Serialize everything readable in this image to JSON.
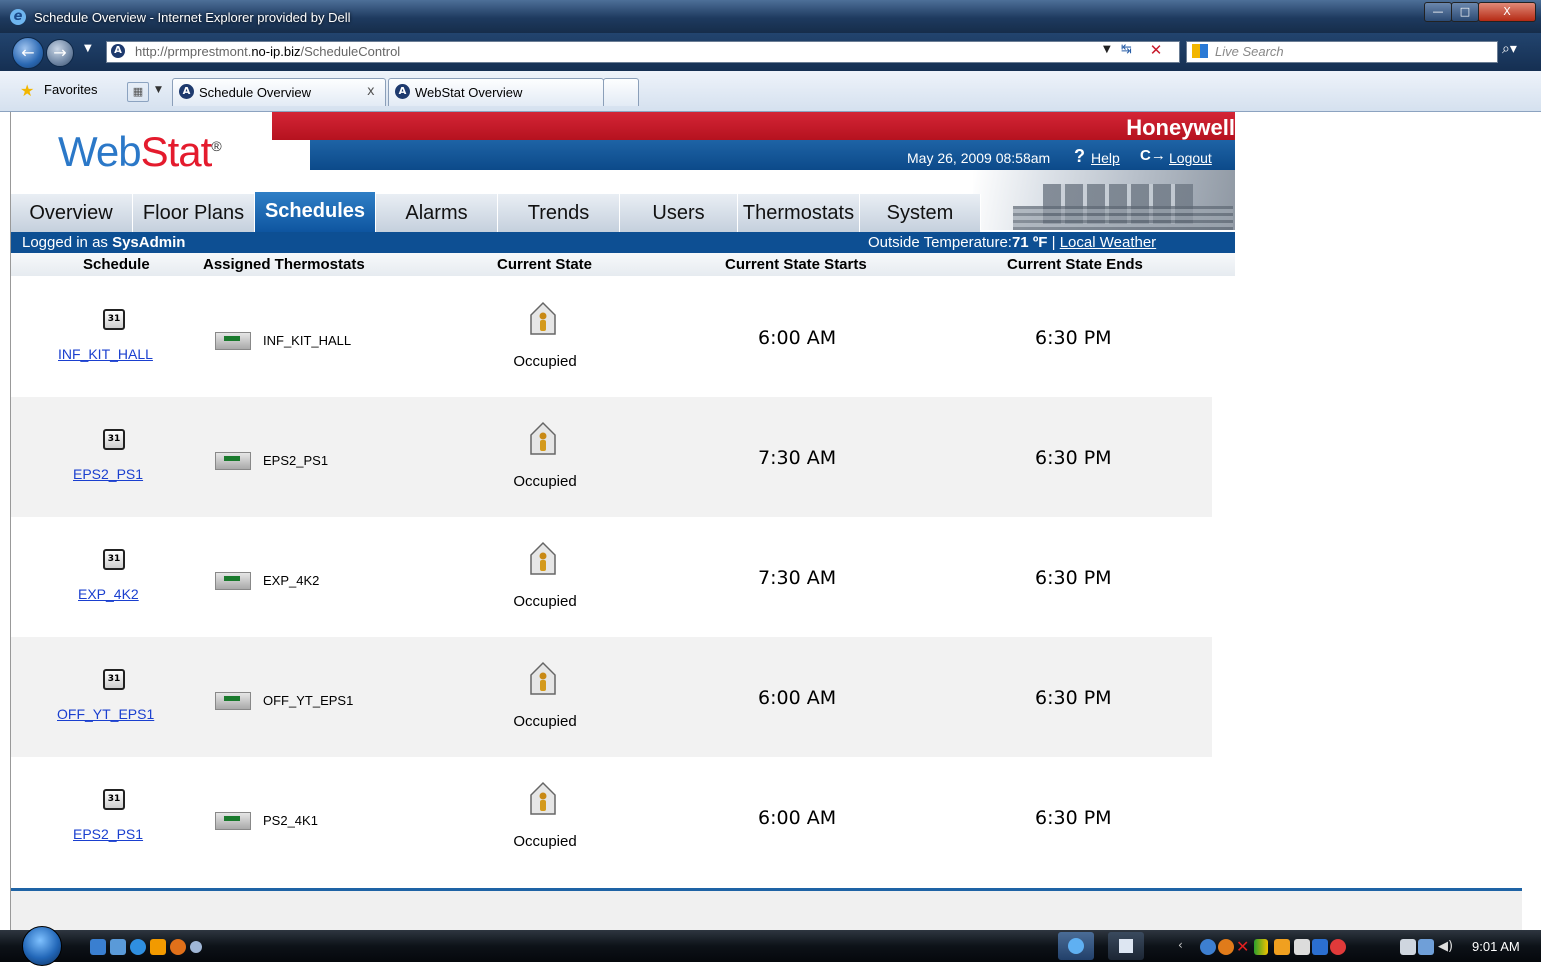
{
  "browser": {
    "window_title": "Schedule Overview - Internet Explorer provided by Dell",
    "url_prefix": "http://prmprestmont.",
    "url_host": "no-ip.biz",
    "url_path": "/ScheduleControl",
    "search_placeholder": "Live Search",
    "favorites_label": "Favorites",
    "tabs": [
      {
        "label": "Schedule Overview",
        "active": true
      },
      {
        "label": "WebStat Overview",
        "active": false
      }
    ],
    "tab_close": "x"
  },
  "app": {
    "brand": "Honeywell",
    "logo_web": "Web",
    "logo_stat": "Stat",
    "logo_reg": "®",
    "datetime": "May 26, 2009 08:58am",
    "help_icon": "?",
    "help_label": "Help",
    "logout_icon": "C→",
    "logout_label": "Logout",
    "nav_tabs": [
      {
        "label": "Overview",
        "active": false
      },
      {
        "label": "Floor Plans",
        "active": false
      },
      {
        "label": "Schedules",
        "active": true
      },
      {
        "label": "Alarms",
        "active": false
      },
      {
        "label": "Trends",
        "active": false
      },
      {
        "label": "Users",
        "active": false
      },
      {
        "label": "Thermostats",
        "active": false
      },
      {
        "label": "System",
        "active": false
      }
    ],
    "logged_in_prefix": "Logged in as ",
    "logged_in_user": "SysAdmin",
    "outside_temp_label": "Outside Temperature:",
    "outside_temp_value": "71 ºF",
    "separator": "|",
    "local_weather": "Local Weather"
  },
  "table": {
    "headers": {
      "schedule": "Schedule",
      "assigned": "Assigned Thermostats",
      "state": "Current State",
      "starts": "Current State Starts",
      "ends": "Current State Ends"
    },
    "calendar_icon_text": "31",
    "rows": [
      {
        "schedule": "INF_KIT_HALL",
        "thermostat": "INF_KIT_HALL",
        "state": "Occupied",
        "starts": "6:00 AM",
        "ends": "6:30 PM"
      },
      {
        "schedule": "EPS2_PS1",
        "thermostat": "EPS2_PS1",
        "state": "Occupied",
        "starts": "7:30 AM",
        "ends": "6:30 PM"
      },
      {
        "schedule": "EXP_4K2",
        "thermostat": "EXP_4K2",
        "state": "Occupied",
        "starts": "7:30 AM",
        "ends": "6:30 PM"
      },
      {
        "schedule": "OFF_YT_EPS1",
        "thermostat": "OFF_YT_EPS1",
        "state": "Occupied",
        "starts": "6:00 AM",
        "ends": "6:30 PM"
      },
      {
        "schedule": "EPS2_PS1",
        "thermostat": "PS2_4K1",
        "state": "Occupied",
        "starts": "6:00 AM",
        "ends": "6:30 PM"
      }
    ]
  },
  "taskbar": {
    "clock": "9:01 AM"
  },
  "colors": {
    "red": "#c8192a",
    "blue": "#0d4f93",
    "link": "#1a3fcf"
  }
}
